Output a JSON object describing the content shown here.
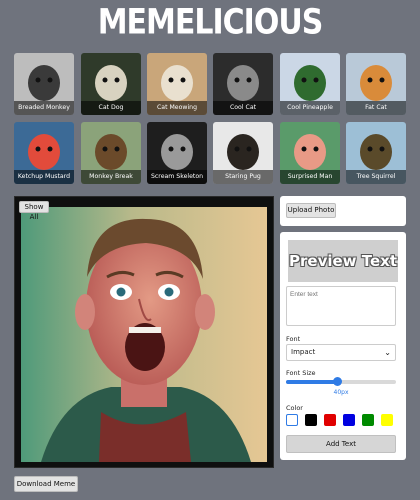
{
  "app": {
    "logo": "MEMELICIOUS"
  },
  "gallery": [
    {
      "label": "Breaded Monkey",
      "bg": "#bdbdbd",
      "fg": "#3a3a3a"
    },
    {
      "label": "Cat Dog",
      "bg": "#2f3a2a",
      "fg": "#d8d2c0"
    },
    {
      "label": "Cat Meowing",
      "bg": "#c9a67a",
      "fg": "#e9e0cf"
    },
    {
      "label": "Cool Cat",
      "bg": "#2c2c2c",
      "fg": "#8a8a8a"
    },
    {
      "label": "Cool Pineapple",
      "bg": "#cbd7e6",
      "fg": "#2f6b2f"
    },
    {
      "label": "Fat Cat",
      "bg": "#b9c9d8",
      "fg": "#d98b3a"
    },
    {
      "label": "Ketchup Mustard",
      "bg": "#3c6a96",
      "fg": "#e24b3b"
    },
    {
      "label": "Monkey Break",
      "bg": "#8ba37a",
      "fg": "#6b4a2a"
    },
    {
      "label": "Scream Skeleton",
      "bg": "#1e1e1e",
      "fg": "#9a9a9a"
    },
    {
      "label": "Staring Pug",
      "bg": "#e8e8e8",
      "fg": "#2a2520"
    },
    {
      "label": "Surprised Man",
      "bg": "#5a9b6a",
      "fg": "#e89a86"
    },
    {
      "label": "Tree Squirrel",
      "bg": "#9dbfd6",
      "fg": "#5a4a2a"
    }
  ],
  "canvas": {
    "show_all_label": "Show All"
  },
  "download": {
    "label": "Download Meme"
  },
  "upload": {
    "label": "Upload Photo"
  },
  "editor": {
    "preview_text": "Preview Text",
    "text_placeholder": "Enter text",
    "font_label": "Font",
    "font_value": "Impact",
    "font_size_label": "Font Size",
    "font_size_value": "40px",
    "font_size_fraction": 0.46,
    "color_label": "Color",
    "colors": [
      "#ffffff",
      "#000000",
      "#e00000",
      "#0000e0",
      "#008a00",
      "#ffff00"
    ],
    "selected_color": "#ffffff",
    "add_text_label": "Add Text"
  }
}
